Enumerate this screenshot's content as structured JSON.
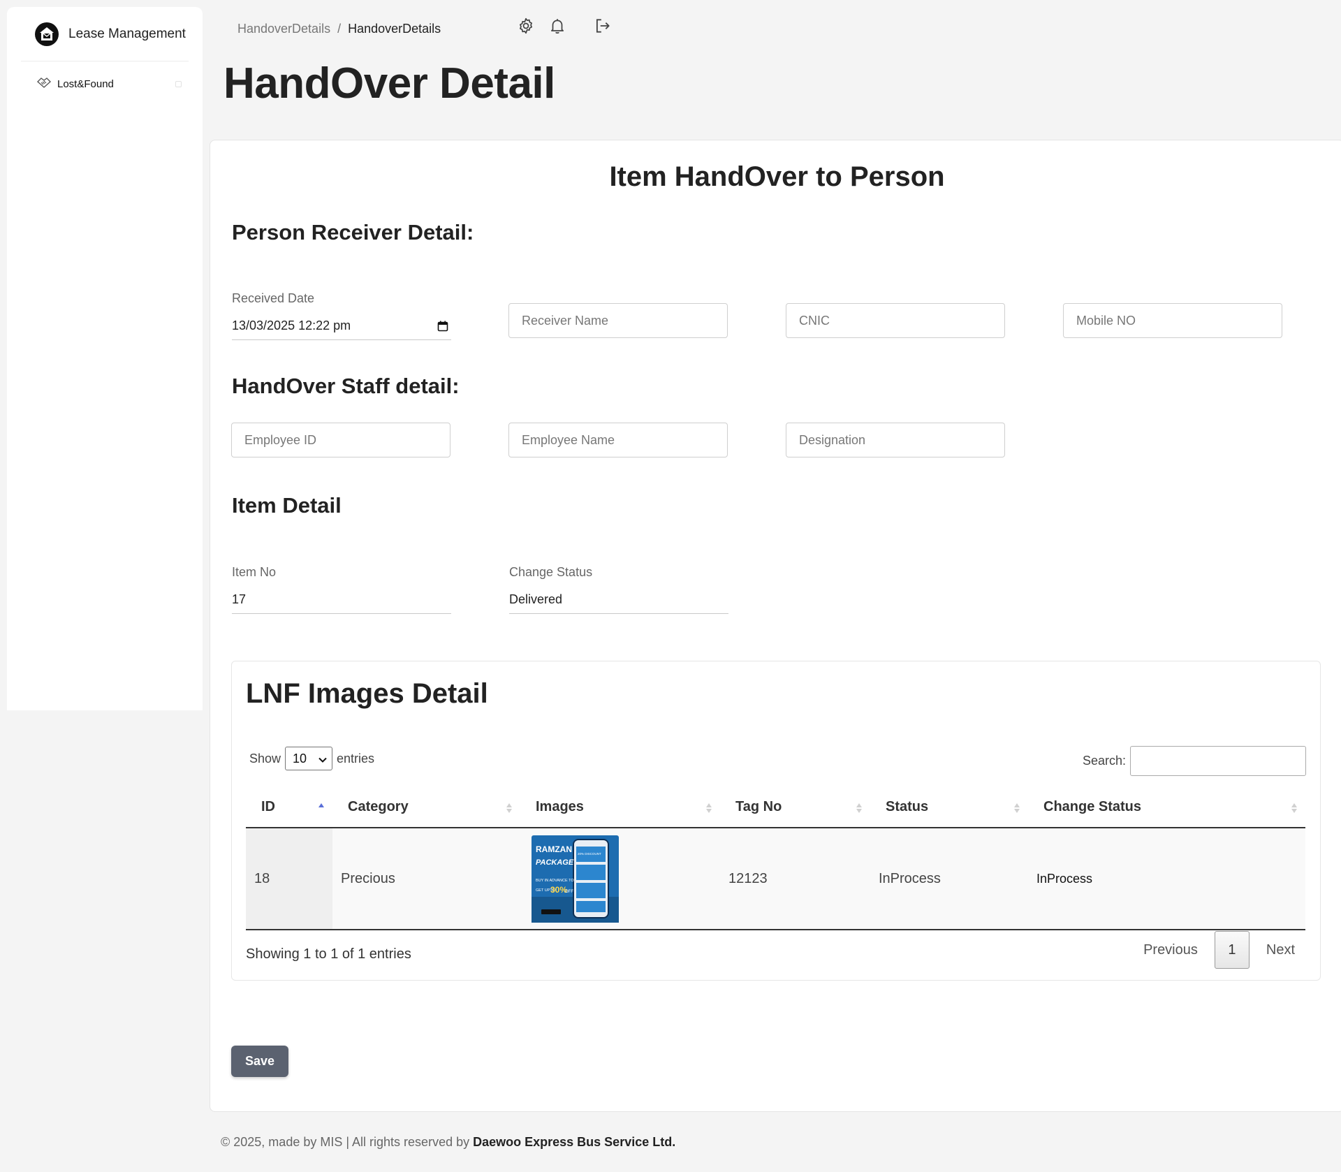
{
  "sidebar": {
    "brand": "Lease Management",
    "items": [
      {
        "label": "Lost&Found",
        "icon": "handshake-icon"
      }
    ]
  },
  "breadcrumb": {
    "parent": "HandoverDetails",
    "separator": "/",
    "current": "HandoverDetails"
  },
  "header": {
    "icons": [
      "gear-icon",
      "bell-icon",
      "logout-icon"
    ]
  },
  "page": {
    "title": "HandOver Detail"
  },
  "form": {
    "title": "Item HandOver to Person",
    "receiver_section": "Person Receiver Detail:",
    "received_date_label": "Received Date",
    "received_date_value": "13/03/2025 12:22  pm",
    "receiver_name_placeholder": "Receiver Name",
    "cnic_placeholder": "CNIC",
    "mobile_placeholder": "Mobile NO",
    "staff_section": "HandOver Staff detail:",
    "employee_id_placeholder": "Employee ID",
    "employee_name_placeholder": "Employee Name",
    "designation_placeholder": "Designation",
    "item_section": "Item Detail",
    "item_no_label": "Item No",
    "item_no_value": "17",
    "change_status_label": "Change Status",
    "change_status_value": "Delivered",
    "save_label": "Save"
  },
  "images_table": {
    "title": "LNF Images Detail",
    "show_label": "Show",
    "entries_label": "entries",
    "page_length": "10",
    "search_label": "Search:",
    "columns": [
      "ID",
      "Category",
      "Images",
      "Tag No",
      "Status",
      "Change Status"
    ],
    "rows": [
      {
        "id": "18",
        "category": "Precious",
        "image_text": [
          "RAMZAN",
          "PACKAGE",
          "BUY IN ADVANCE TO",
          "GET UPTO",
          "30%",
          "OFF",
          "20% DISCOUNT"
        ],
        "tag_no": "12123",
        "status": "InProcess",
        "change_status": "InProcess"
      }
    ],
    "info": "Showing 1 to 1 of 1 entries",
    "previous_label": "Previous",
    "page_number": "1",
    "next_label": "Next"
  },
  "footer": {
    "text": "© 2025, made by MIS | All rights reserved by ",
    "company": "Daewoo Express Bus Service Ltd."
  },
  "colors": {
    "background": "#f4f4f4",
    "save_button": "#5b6270",
    "sort_active": "#5a6fd8"
  }
}
